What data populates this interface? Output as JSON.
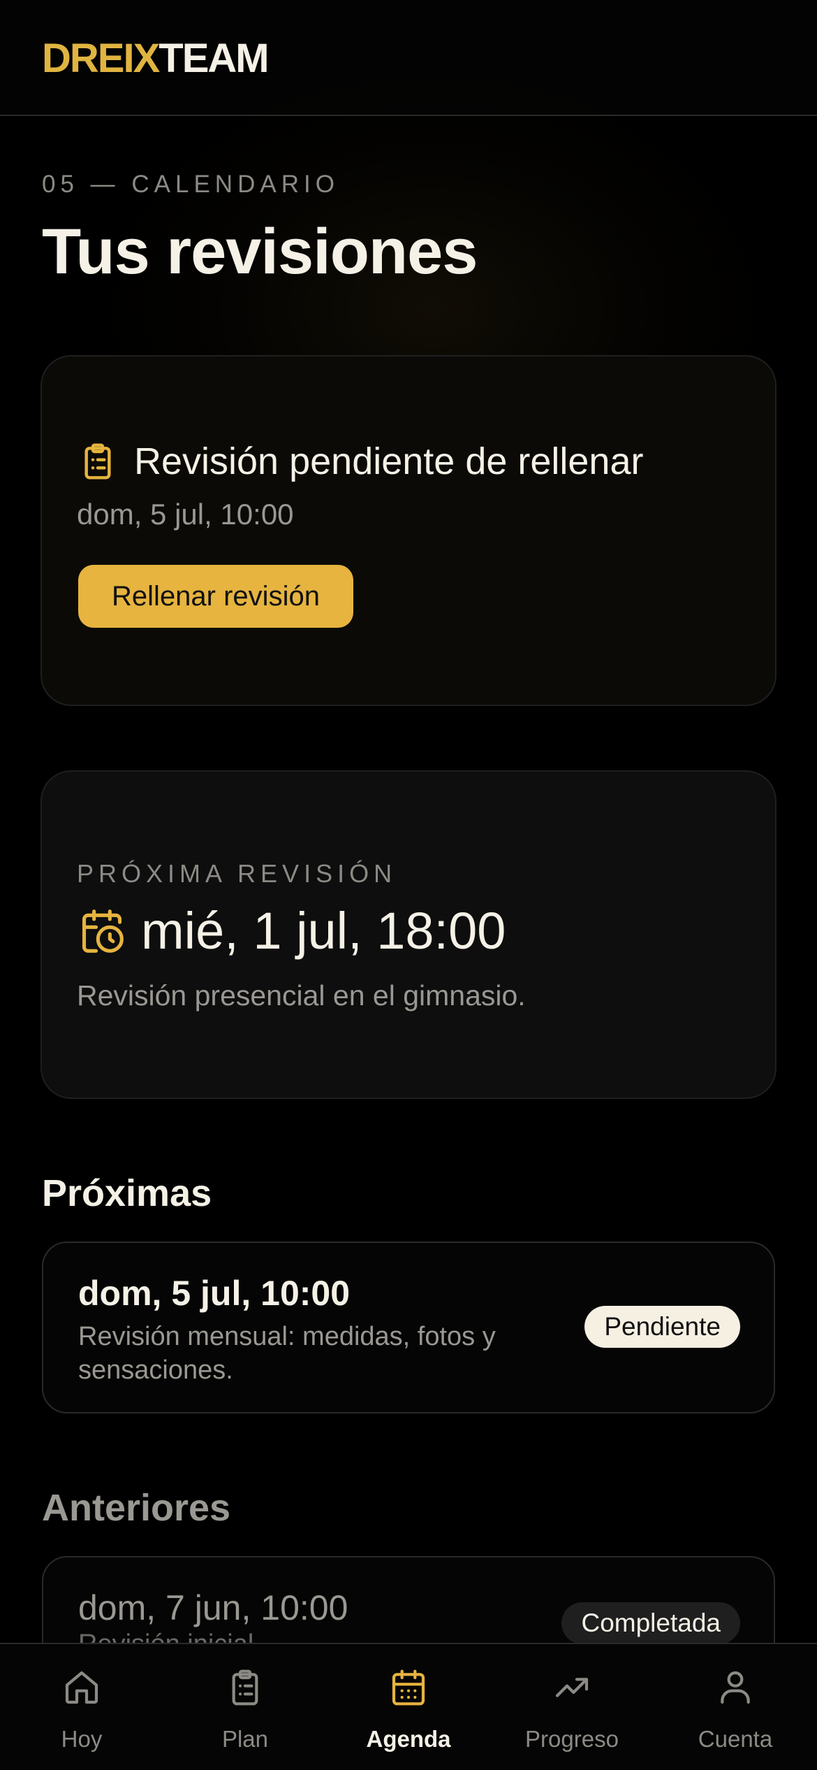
{
  "header": {
    "logo_part1": "DREIX",
    "logo_part2": "TEAM"
  },
  "page": {
    "eyebrow": "05 — CALENDARIO",
    "title": "Tus revisiones"
  },
  "pending_card": {
    "title": "Revisión pendiente de rellenar",
    "date": "dom, 5 jul, 10:00",
    "button_label": "Rellenar revisión",
    "icon": "clipboard-list-icon"
  },
  "next_card": {
    "label": "PRÓXIMA REVISIÓN",
    "date": "mié, 1 jul, 18:00",
    "description": "Revisión presencial en el gimnasio.",
    "icon": "calendar-clock-icon"
  },
  "upcoming": {
    "title": "Próximas",
    "items": [
      {
        "date": "dom, 5 jul, 10:00",
        "description": "Revisión mensual: medidas, fotos y sensaciones.",
        "status": "Pendiente"
      }
    ]
  },
  "previous": {
    "title": "Anteriores",
    "items": [
      {
        "date": "dom, 7 jun, 10:00",
        "description": "Revisión inicial",
        "status": "Completada"
      }
    ]
  },
  "nav": {
    "items": [
      {
        "label": "Hoy",
        "icon": "home-icon"
      },
      {
        "label": "Plan",
        "icon": "clipboard-icon"
      },
      {
        "label": "Agenda",
        "icon": "calendar-icon"
      },
      {
        "label": "Progreso",
        "icon": "trending-up-icon"
      },
      {
        "label": "Cuenta",
        "icon": "user-icon"
      }
    ],
    "active": "Agenda"
  },
  "colors": {
    "accent": "#e6b43f",
    "background": "#000000",
    "text": "#f5f1e6",
    "muted": "#9a9892"
  }
}
